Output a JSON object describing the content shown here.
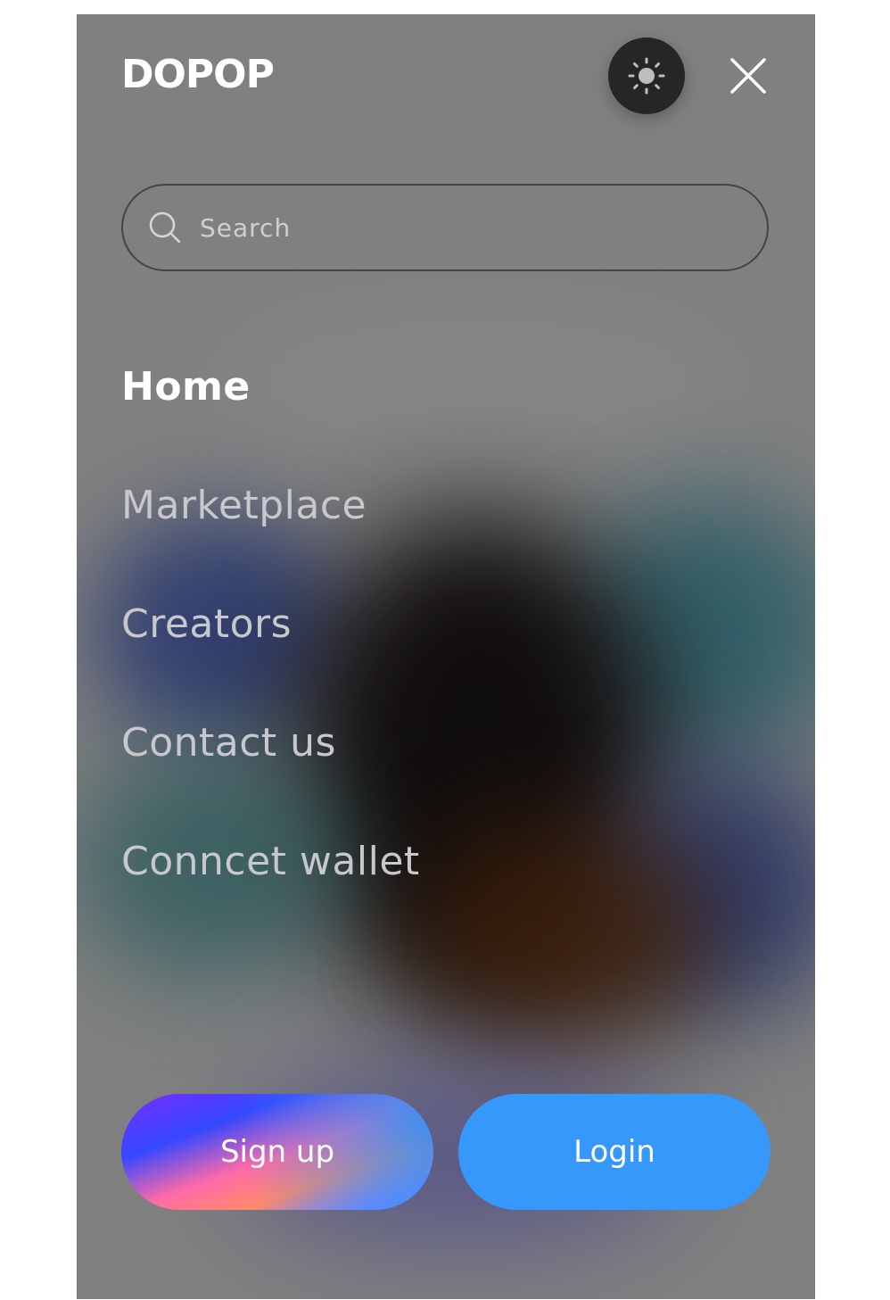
{
  "header": {
    "logo_text": "DOPOP",
    "theme_toggle_icon": "sun-icon",
    "close_icon": "close-icon"
  },
  "search": {
    "placeholder": "Search",
    "value": "",
    "icon": "search-icon"
  },
  "nav": {
    "items": [
      {
        "label": "Home",
        "active": true
      },
      {
        "label": "Marketplace",
        "active": false
      },
      {
        "label": "Creators",
        "active": false
      },
      {
        "label": "Contact us",
        "active": false
      },
      {
        "label": "Conncet wallet",
        "active": false
      }
    ]
  },
  "actions": {
    "signup_label": "Sign up",
    "login_label": "Login"
  },
  "colors": {
    "panel_bg": "#808080",
    "login_blue": "#3698fb",
    "toggle_bg": "#262626",
    "nav_active": "#ffffff",
    "nav_inactive": "#c8c8cc"
  }
}
